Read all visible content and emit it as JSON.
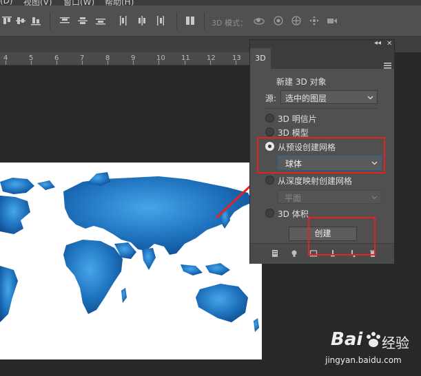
{
  "menubar": {
    "items": [
      "(D)",
      "视图(V)",
      "窗口(W)",
      "帮助(H)"
    ]
  },
  "optionsbar": {
    "mode_label": "3D 模式："
  },
  "ruler": {
    "labels": [
      "4",
      "5",
      "6",
      "7",
      "8",
      "9",
      "10",
      "11",
      "12",
      "13"
    ]
  },
  "panel": {
    "tab_label": "3D",
    "collapse_label": "◂◂",
    "close_label": "✕",
    "section_title": "新建 3D 对象",
    "source_label": "源:",
    "source_value": "选中的图层",
    "options": [
      {
        "label": "3D 明信片",
        "selected": false
      },
      {
        "label": "3D 模型",
        "selected": false
      },
      {
        "label": "从预设创建网格",
        "selected": true
      },
      {
        "label": "从深度映射创建网格",
        "selected": false
      },
      {
        "label": "3D 体积",
        "selected": false
      }
    ],
    "preset_value": "球体",
    "depth_value": "平面",
    "create_label": "创建"
  },
  "watermark": {
    "brand": "Bai",
    "brand_suffix": "经验",
    "url": "jingyan.baidu.com"
  },
  "colors": {
    "highlight": "#e8201e",
    "panel_bg": "#505050",
    "workspace_bg": "#282828",
    "ocean": "#ffffff",
    "land_light": "#3f9be0",
    "land_dark": "#0d4f92"
  }
}
